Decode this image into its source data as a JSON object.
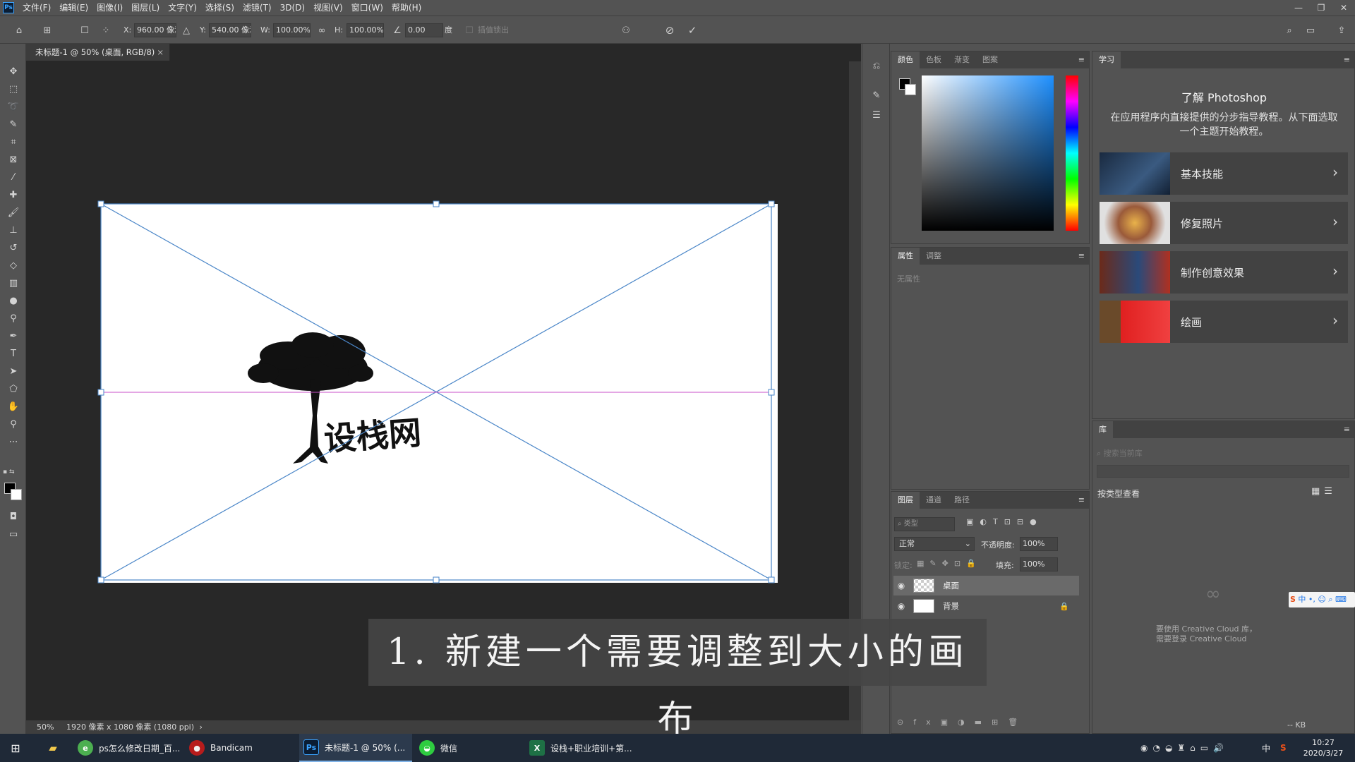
{
  "app": {
    "logo": "Ps",
    "menu": [
      "文件(F)",
      "编辑(E)",
      "图像(I)",
      "图层(L)",
      "文字(Y)",
      "选择(S)",
      "滤镜(T)",
      "3D(D)",
      "视图(V)",
      "窗口(W)",
      "帮助(H)"
    ],
    "window_controls": [
      "—",
      "❐",
      "✕"
    ]
  },
  "options_bar": {
    "x_label": "X:",
    "x_value": "960.00 像素",
    "y_label": "Y:",
    "y_value": "540.00 像素",
    "w_label": "W:",
    "w_value": "100.00%",
    "h_label": "H:",
    "h_value": "100.00%",
    "angle_value": "0.00",
    "angle_unit": "度",
    "interp_label": "插值锁出"
  },
  "document": {
    "tab_title": "未标题-1 @ 50% (桌面, RGB/8)",
    "tab_close": "×",
    "canvas_text": "设栈网",
    "status_zoom": "50%",
    "status_info": "1920 像素 x 1080 像素 (1080 ppi)"
  },
  "caption": "1. 新建一个需要调整到大小的画布",
  "color_panel": {
    "tabs": [
      "颜色",
      "色板",
      "渐变",
      "图案"
    ],
    "active": 0
  },
  "props_panel": {
    "tabs": [
      "属性",
      "调整"
    ],
    "empty_text": "无属性"
  },
  "layers_panel": {
    "tabs": [
      "图层",
      "通道",
      "路径"
    ],
    "filter_placeholder": "类型",
    "blend_mode": "正常",
    "opacity_label": "不透明度:",
    "opacity_value": "100%",
    "lock_label": "锁定:",
    "fill_label": "填充:",
    "fill_value": "100%",
    "layers": [
      {
        "name": "桌面",
        "selected": true,
        "locked": false
      },
      {
        "name": "背景",
        "selected": false,
        "locked": true
      }
    ]
  },
  "learn_panel": {
    "tab": "学习",
    "title": "了解 Photoshop",
    "description": "在应用程序内直接提供的分步指导教程。从下面选取一个主题开始教程。",
    "topics": [
      "基本技能",
      "修复照片",
      "制作创意效果",
      "绘画"
    ]
  },
  "library_panel": {
    "tab": "库",
    "search_placeholder": "搜索当前库",
    "view_by": "按类型查看",
    "login_text_1": "要使用 Creative Cloud 库，",
    "login_text_2": "需要登录 Creative Cloud",
    "size": "-- KB"
  },
  "taskbar": {
    "items": [
      {
        "label": "ps怎么修改日期_百...",
        "icon": "browser-icon"
      },
      {
        "label": "Bandicam",
        "icon": "record-icon"
      },
      {
        "label": "未标题-1 @ 50% (...",
        "icon": "photoshop-icon",
        "active": true
      },
      {
        "label": "微信",
        "icon": "wechat-icon"
      },
      {
        "label": "设栈+职业培训+第...",
        "icon": "excel-icon"
      }
    ],
    "ime": "中",
    "time": "10:27",
    "date": "2020/3/27"
  },
  "colors": {
    "accent": "#31a8ff",
    "guide": "#c84fc8",
    "transform": "#4a86c8"
  }
}
